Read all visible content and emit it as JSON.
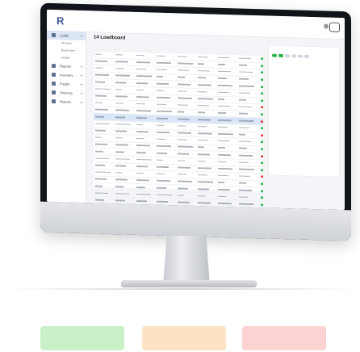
{
  "app": {
    "logo_text": "R",
    "user_line1": "",
    "user_line2": "",
    "help_label": ""
  },
  "sidebar": {
    "items": [
      {
        "label": "Loads",
        "active": true
      },
      {
        "label": "Reports"
      },
      {
        "label": "Inventory"
      },
      {
        "label": "Freight"
      },
      {
        "label": "Directory"
      },
      {
        "label": "Reports"
      }
    ],
    "subitems": [
      "All loads",
      "Board view",
      "Details"
    ]
  },
  "main": {
    "title": "14 Loadboard"
  },
  "table": {
    "columns": [
      "",
      "",
      "",
      "",
      "",
      "",
      "",
      "",
      ""
    ],
    "row_status": [
      "green",
      "green",
      "green",
      "green",
      "green",
      "green",
      "green",
      "red",
      "green",
      "red",
      "green",
      "red",
      "green",
      "green",
      "red",
      "green",
      "green",
      "red",
      "green",
      "green",
      "green",
      "green",
      "green",
      "green",
      "green",
      "red",
      "green"
    ],
    "selected_row": 9
  },
  "colors": {
    "green": "#28b24a",
    "red": "#e23b3b",
    "orange": "#f0a02a",
    "swatch_green": "#c9f0c7",
    "swatch_orange": "#fde2c3",
    "swatch_red": "#fcd2d2"
  }
}
